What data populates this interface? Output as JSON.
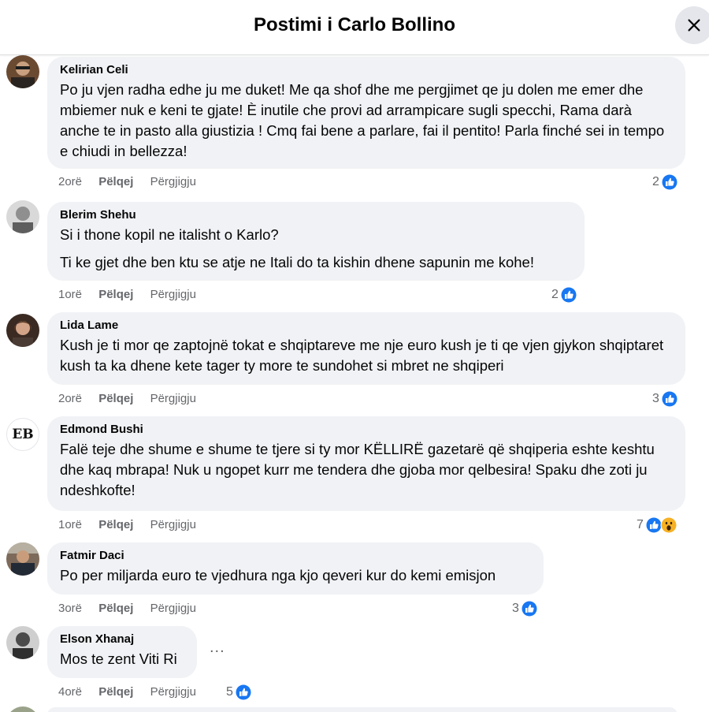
{
  "header": {
    "title": "Postimi i Carlo Bollino"
  },
  "comments": [
    {
      "author": "Kelirian Celi",
      "text": [
        "Po ju vjen radha edhe ju me duket! Me qa shof dhe me pergjimet qe ju dolen me emer dhe mbiemer nuk e keni te gjate! È inutile che provi ad arrampicare sugli specchi, Rama darà anche te in pasto alla giustizia ! Cmq fai bene a parlare, fai il pentito! Parla finché sei in tempo e chiudi in bellezza!"
      ],
      "time": "2orë",
      "like": "Pëlqej",
      "reply": "Përgjigju",
      "reaction_count": "2",
      "reactions": [
        "like-icon"
      ]
    },
    {
      "author": "Blerim Shehu",
      "text": [
        "Si i thone kopil ne italisht o Karlo?",
        "Ti ke gjet dhe ben ktu se atje ne Itali do ta kishin dhene sapunin me kohe!"
      ],
      "time": "1orë",
      "like": "Pëlqej",
      "reply": "Përgjigju",
      "reaction_count": "2",
      "reactions": [
        "like-icon"
      ]
    },
    {
      "author": "Lida Lame",
      "text": [
        "Kush je ti mor qe zaptojnë tokat e shqiptareve me nje euro kush je ti qe vjen gjykon shqiptaret kush ta ka dhene kete tager ty more te sundohet si mbret ne shqiperi"
      ],
      "time": "2orë",
      "like": "Pëlqej",
      "reply": "Përgjigju",
      "reaction_count": "3",
      "reactions": [
        "like-icon"
      ]
    },
    {
      "author": "Edmond Bushi",
      "avatar_text": "EB",
      "text": [
        "Falë teje dhe shume e shume te tjere si ty mor KËLLIRË gazetarë që shqiperia eshte keshtu dhe kaq mbrapa! Nuk u ngopet kurr me tendera dhe gjoba mor qelbesira! Spaku dhe zoti ju ndeshkofte!"
      ],
      "time": "1orë",
      "like": "Pëlqej",
      "reply": "Përgjigju",
      "reaction_count": "7",
      "reactions": [
        "like-icon",
        "wow-icon"
      ]
    },
    {
      "author": "Fatmir Daci",
      "text": [
        "Po per miljarda euro te vjedhura nga kjo qeveri kur do kemi emisjon"
      ],
      "time": "3orë",
      "like": "Pëlqej",
      "reply": "Përgjigju",
      "reaction_count": "3",
      "reactions": [
        "like-icon"
      ]
    },
    {
      "author": "Elson Xhanaj",
      "text": [
        "Mos te zent Viti Ri"
      ],
      "time": "4orë",
      "like": "Pëlqej",
      "reply": "Përgjigju",
      "reaction_count": "5",
      "reactions": [
        "like-icon"
      ],
      "more": "..."
    }
  ],
  "colors": {
    "like_blue": "#1877f2",
    "wow_yellow": "#f7b125",
    "bubble_bg": "#f0f2f5",
    "muted": "#65676b"
  }
}
